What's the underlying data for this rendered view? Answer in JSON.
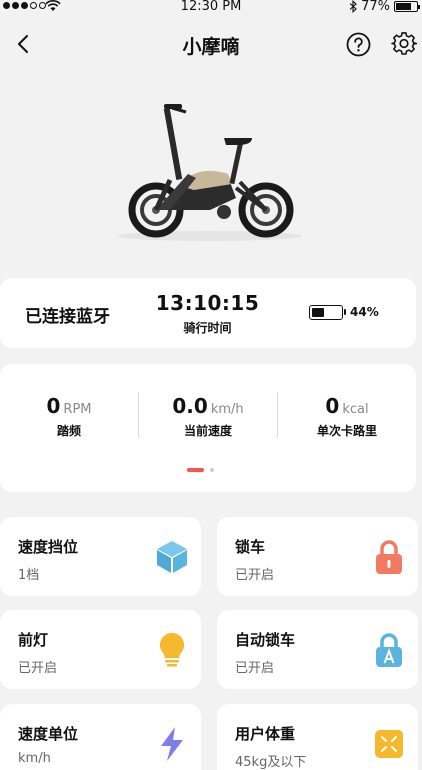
{
  "status_bar": {
    "time": "12:30 PM",
    "battery_pct_text": "77%",
    "battery_level": 0.77,
    "signal_dots_filled": 3,
    "icons": [
      "signal-dots-icon",
      "wifi-icon",
      "bluetooth-icon",
      "battery-icon"
    ]
  },
  "nav": {
    "title": "小摩嘀",
    "back_icon": "chevron-left-icon",
    "help_icon": "question-circle-icon",
    "settings_icon": "gear-icon"
  },
  "bike_image": "folding-ebike-image",
  "status": {
    "bluetooth": "已连接蓝牙",
    "ride_time": "13:10:15",
    "ride_time_label": "骑行时间",
    "battery_pct": "44%",
    "battery_level": 0.44
  },
  "metrics": [
    {
      "value": "0",
      "unit": "RPM",
      "label": "踏频"
    },
    {
      "value": "0.0",
      "unit": "km/h",
      "label": "当前速度"
    },
    {
      "value": "0",
      "unit": "kcal",
      "label": "单次卡路里"
    }
  ],
  "pager": {
    "pages": 2,
    "active": 1
  },
  "tiles": [
    {
      "title": "速度挡位",
      "subtitle": "1档",
      "icon": "cube-icon",
      "color": "#5ab4e0"
    },
    {
      "title": "锁车",
      "subtitle": "已开启",
      "icon": "padlock-icon",
      "color": "#f27a63"
    },
    {
      "title": "前灯",
      "subtitle": "已开启",
      "icon": "lightbulb-icon",
      "color": "#f5b82e"
    },
    {
      "title": "自动锁车",
      "subtitle": "已开启",
      "icon": "auto-lock-icon",
      "color": "#5ab4e0"
    },
    {
      "title": "速度单位",
      "subtitle": "km/h",
      "icon": "lightning-icon",
      "color": "#7b7fe6"
    },
    {
      "title": "用户体重",
      "subtitle": "45kg及以下",
      "icon": "weight-scale-icon",
      "color": "#f5b82e"
    }
  ],
  "colors": {
    "accent": "#f2584d",
    "background": "#f2f2f2"
  }
}
